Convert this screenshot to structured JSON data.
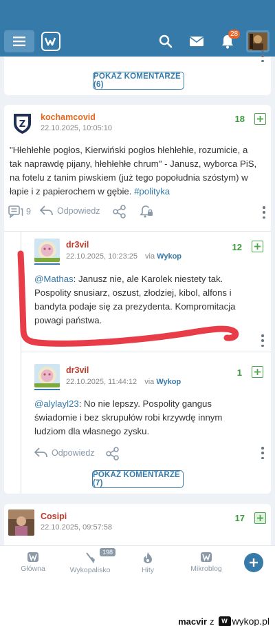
{
  "top_bar": {
    "notification_count": "28"
  },
  "cards": {
    "top": {
      "show_comments_label": "POKAŻ KOMENTARZE (6)"
    },
    "main": {
      "post": {
        "author": "kochamcovid",
        "date": "22.10.2025, 10:05:10",
        "votes": "18",
        "text_lines": [
          "\"Hłehłehłe pogłos, Kierwiński pogłos hłehłehłe, rozumicie, a",
          "tak naprawdę pijany, hłehłehłe chrum\" - Janusz, wyborca PiS,",
          "na fotelu z tanim piwskiem (już tego popołudnia szóstym) w",
          "łapie i z papierochem w gębie. "
        ],
        "tag": "#polityka",
        "comments_count": "9",
        "reply_label": "Odpowiedz"
      },
      "comments": [
        {
          "author": "dr3vil",
          "date": "22.10.2025, 10:23:25",
          "via_prefix": "via",
          "via_source": "Wykop",
          "votes": "12",
          "mention": "@Mathas",
          "text_lines": [
            ": Janusz nie, ale Karolek niestety tak.",
            "Pospolity snusiarz, oszust, złodziej, kibol, alfons i",
            "bandyta podaje się za prezydenta. Kompromitacja",
            "powagi państwa."
          ]
        },
        {
          "author": "dr3vil",
          "date": "22.10.2025, 11:44:12",
          "via_prefix": "via",
          "via_source": "Wykop",
          "votes": "1",
          "mention": "@alylayl23",
          "text_lines": [
            ": No nie lepszy. Pospolity gangus",
            "świadomie i bez skrupułów robi krzywdę innym",
            "ludziom dla własnego zysku."
          ],
          "reply_label": "Odpowiedz"
        }
      ],
      "show_comments_label": "POKAŻ KOMENTARZE (7)"
    },
    "bottom": {
      "author": "Cosipi",
      "date": "22.10.2025, 09:57:58",
      "votes": "17"
    }
  },
  "bottom_nav": {
    "items": [
      {
        "label": "Główna",
        "icon": "wykop-logo-icon"
      },
      {
        "label": "Wykopalisko",
        "icon": "shovel-icon",
        "badge": "198"
      },
      {
        "label": "Hity",
        "icon": "flame-icon"
      },
      {
        "label": "Mikroblog",
        "icon": "mikroblog-icon"
      }
    ],
    "add_icon": "plus-icon"
  },
  "watermark": {
    "user": "macvir",
    "separator": "z",
    "site": "wykop.pl"
  },
  "colors": {
    "topbar": "#367aa9",
    "accent": "#367aa9",
    "author_orange": "#e4671d",
    "author_red": "#c0392b",
    "vote_green": "#3a9b3a",
    "annotation_red": "#e8313f"
  }
}
